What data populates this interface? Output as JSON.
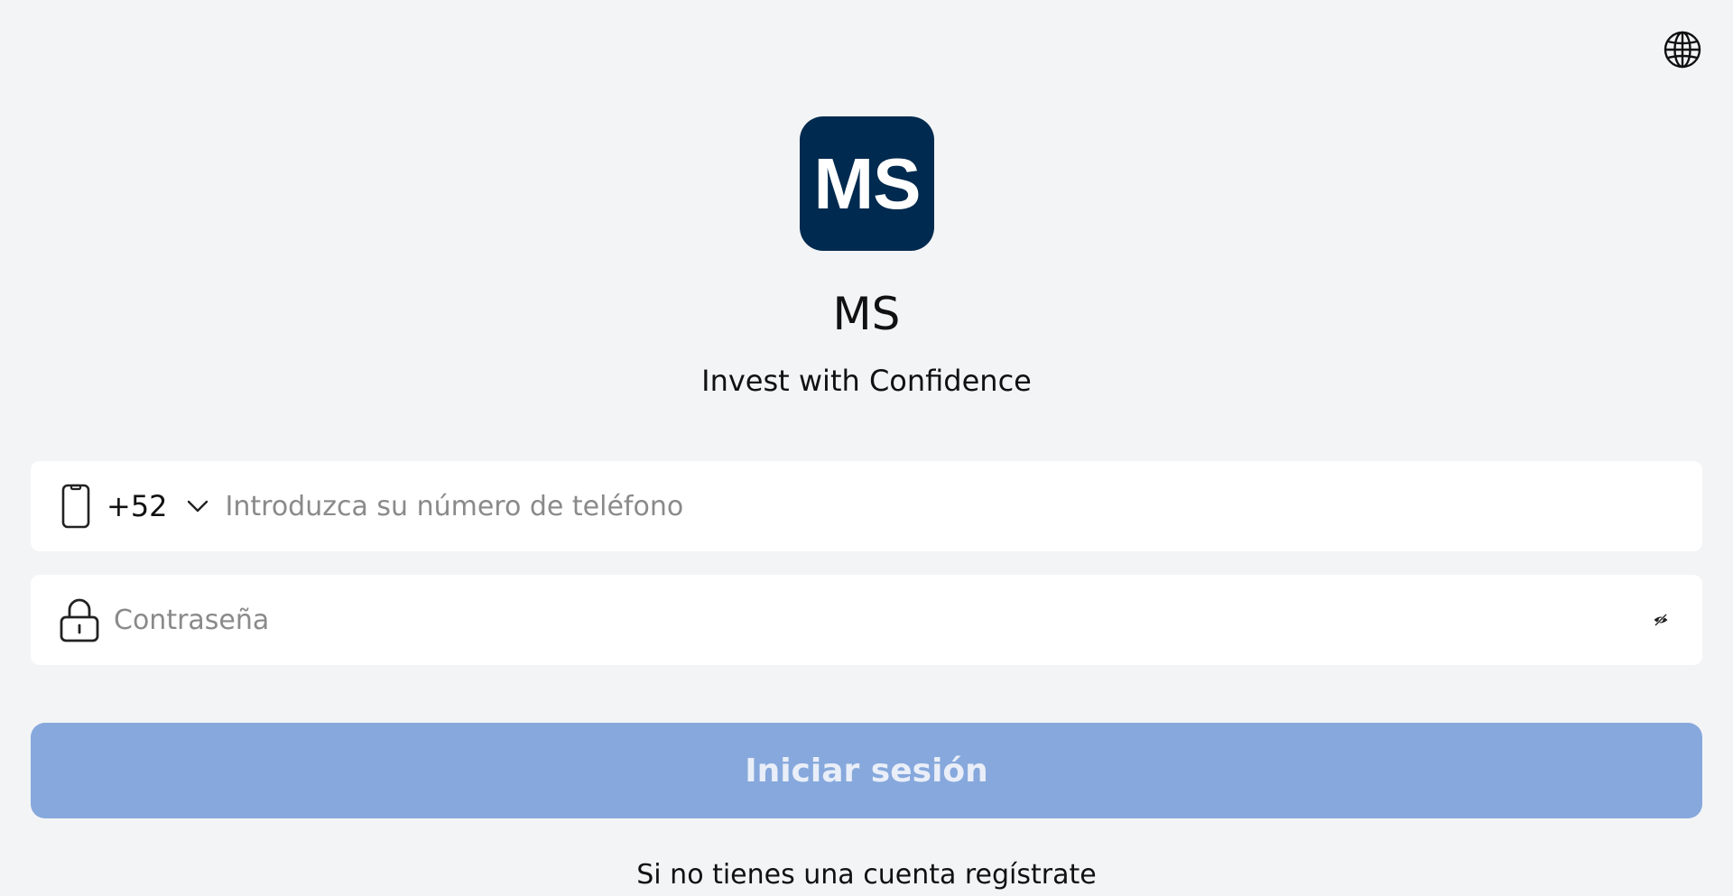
{
  "header": {
    "language_icon": "globe-icon"
  },
  "brand": {
    "logo_text": "MS",
    "app_name": "MS",
    "tagline": "Invest with Confidence",
    "logo_color": "#002a4f"
  },
  "login_form": {
    "phone": {
      "icon": "smartphone-icon",
      "country_code": "+52",
      "dropdown_icon": "chevron-down-icon",
      "value": "",
      "placeholder": "Introduzca su número de teléfono"
    },
    "password": {
      "icon": "lock-icon",
      "value": "",
      "placeholder": "Contraseña",
      "toggle_icon": "eye-off-icon"
    },
    "submit_label": "Iniciar sesión",
    "submit_color": "#86a8dc",
    "register_text": "Si no tienes una cuenta regístrate"
  }
}
